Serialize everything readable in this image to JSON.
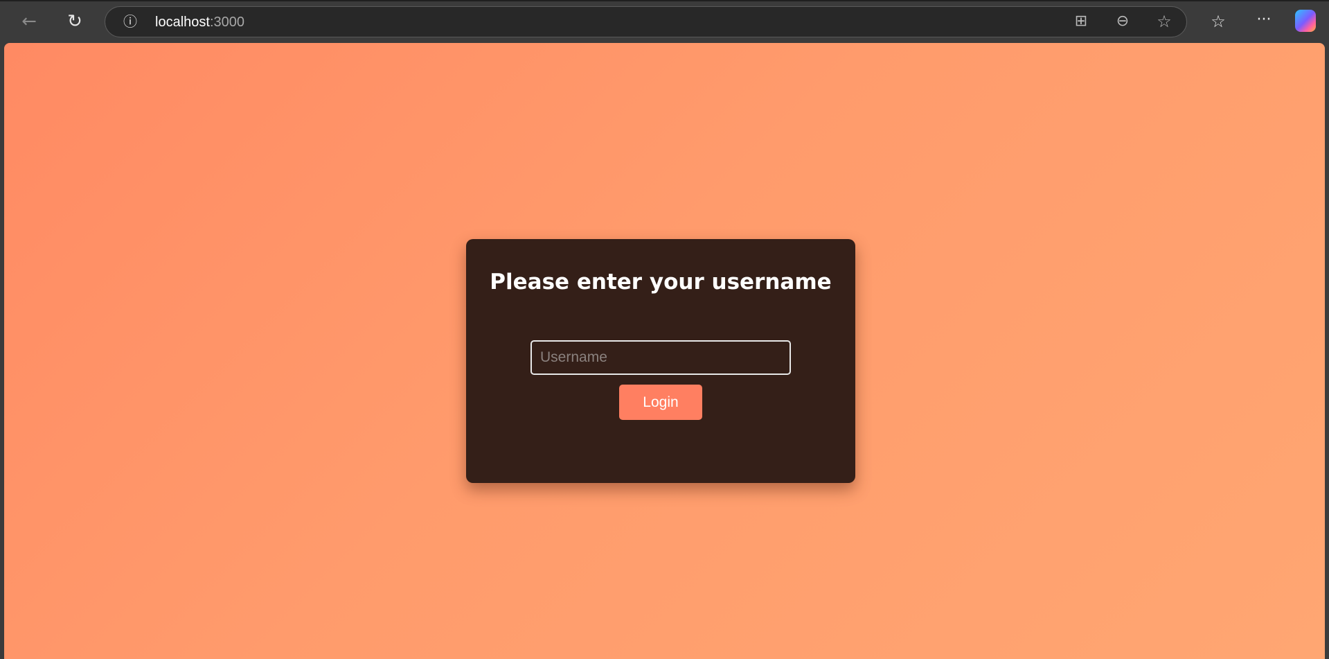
{
  "browser": {
    "url_host": "localhost",
    "url_port": ":3000",
    "icons": [
      "back-icon",
      "refresh-icon",
      "site-info-icon",
      "split-screen-icon",
      "zoom-out-icon",
      "favorite-star-icon",
      "favorites-list-icon",
      "more-menu-icon",
      "copilot-icon"
    ]
  },
  "login": {
    "title": "Please enter your username",
    "username_placeholder": "Username",
    "username_value": "",
    "login_label": "Login"
  },
  "colors": {
    "card": "#341f18",
    "button": "#ff7f61",
    "bg_start": "#ff8a63",
    "bg_end": "#ffa672"
  }
}
